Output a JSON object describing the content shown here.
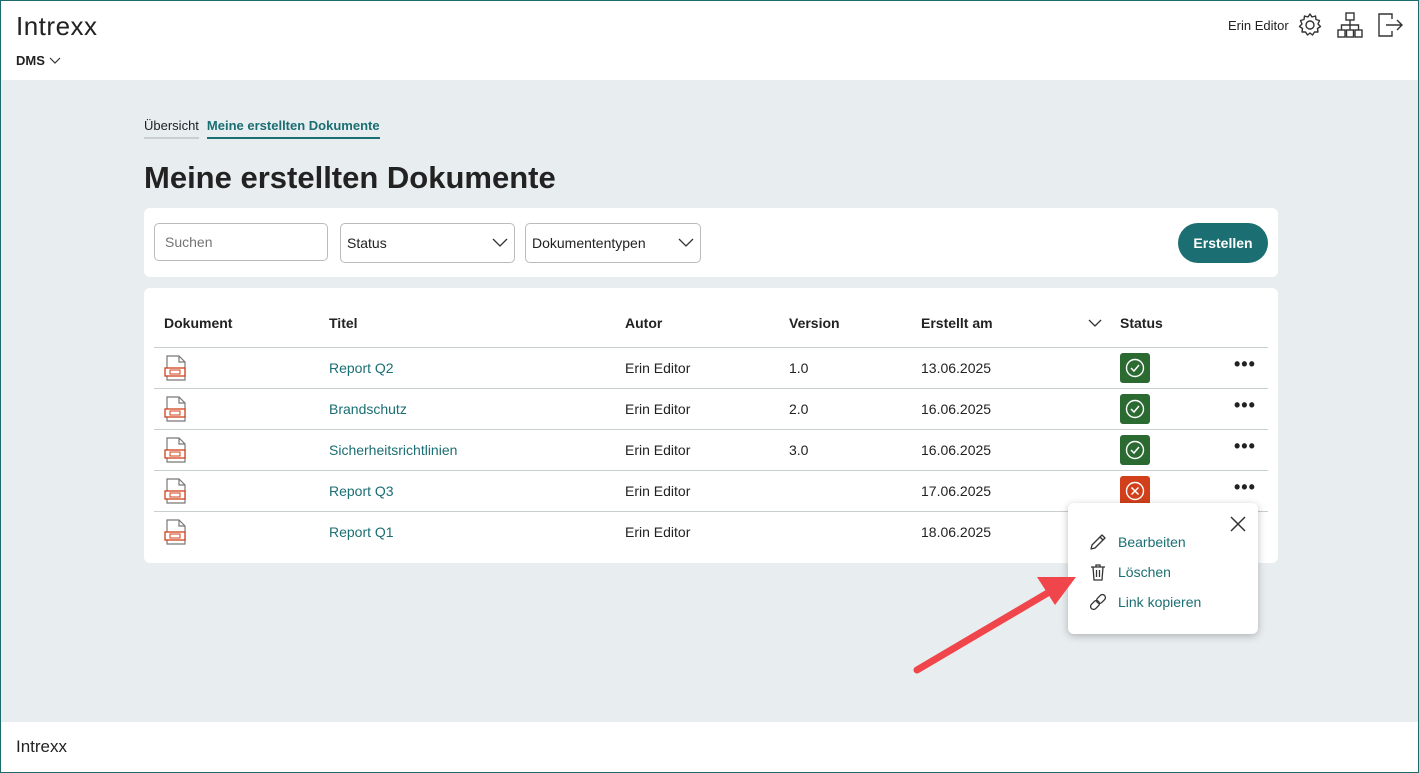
{
  "header": {
    "logo": "Intrexx",
    "app_switcher": "DMS",
    "user_name": "Erin Editor",
    "icons": [
      "gear-icon",
      "sitemap-icon",
      "logout-icon"
    ]
  },
  "tabs": [
    {
      "label": "Übersicht",
      "active": false
    },
    {
      "label": "Meine erstellten Dokumente",
      "active": true
    }
  ],
  "page_title": "Meine erstellten Dokumente",
  "filters": {
    "search_placeholder": "Suchen",
    "status_label": "Status",
    "doctype_label": "Dokumententypen",
    "create_label": "Erstellen"
  },
  "table": {
    "columns": [
      "Dokument",
      "Titel",
      "Autor",
      "Version",
      "Erstellt am",
      "Status"
    ],
    "rows": [
      {
        "title": "Report Q2",
        "author": "Erin Editor",
        "version": "1.0",
        "created": "13.06.2025",
        "status": "ok"
      },
      {
        "title": "Brandschutz",
        "author": "Erin Editor",
        "version": "2.0",
        "created": "16.06.2025",
        "status": "ok"
      },
      {
        "title": "Sicherheitsrichtlinien",
        "author": "Erin Editor",
        "version": "3.0",
        "created": "16.06.2025",
        "status": "ok"
      },
      {
        "title": "Report Q3",
        "author": "Erin Editor",
        "version": "",
        "created": "17.06.2025",
        "status": "rejected"
      },
      {
        "title": "Report Q1",
        "author": "Erin Editor",
        "version": "",
        "created": "18.06.2025",
        "status": ""
      }
    ],
    "more_label": "•••"
  },
  "context_menu": {
    "items": [
      {
        "label": "Bearbeiten",
        "icon": "pencil-icon"
      },
      {
        "label": "Löschen",
        "icon": "trash-icon"
      },
      {
        "label": "Link kopieren",
        "icon": "link-icon"
      }
    ]
  },
  "footer": {
    "logo": "Intrexx"
  },
  "colors": {
    "accent": "#1b6e72",
    "ok": "#2b6b32",
    "error": "#d1401a",
    "arrow": "#f0464b"
  }
}
